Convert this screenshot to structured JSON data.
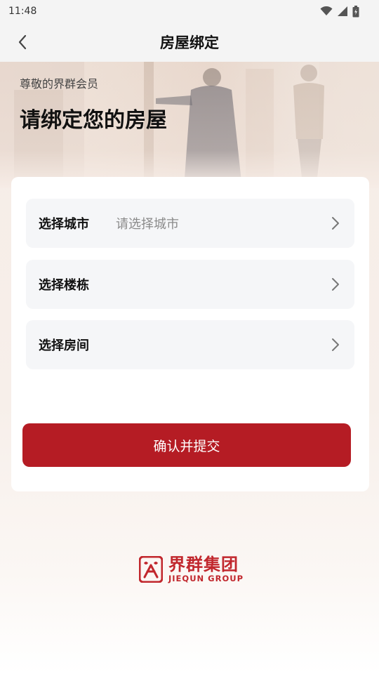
{
  "status_bar": {
    "time": "11:48",
    "icons": [
      "wifi-icon",
      "signal-icon",
      "battery-icon"
    ]
  },
  "nav": {
    "title": "房屋绑定",
    "back_icon": "chevron-left-icon"
  },
  "hero": {
    "greeting": "尊敬的界群会员",
    "title": "请绑定您的房屋"
  },
  "form": {
    "rows": [
      {
        "label": "选择城市",
        "placeholder": "请选择城市",
        "icon": "chevron-right-icon"
      },
      {
        "label": "选择楼栋",
        "placeholder": "",
        "icon": "chevron-right-icon"
      },
      {
        "label": "选择房间",
        "placeholder": "",
        "icon": "chevron-right-icon"
      }
    ],
    "submit_label": "确认并提交"
  },
  "brand": {
    "name_cn": "界群集团",
    "name_en": "JIEQUN GROUP"
  },
  "colors": {
    "accent": "#b51c24",
    "brand_red": "#c1272d",
    "row_bg": "#f5f6f8"
  }
}
